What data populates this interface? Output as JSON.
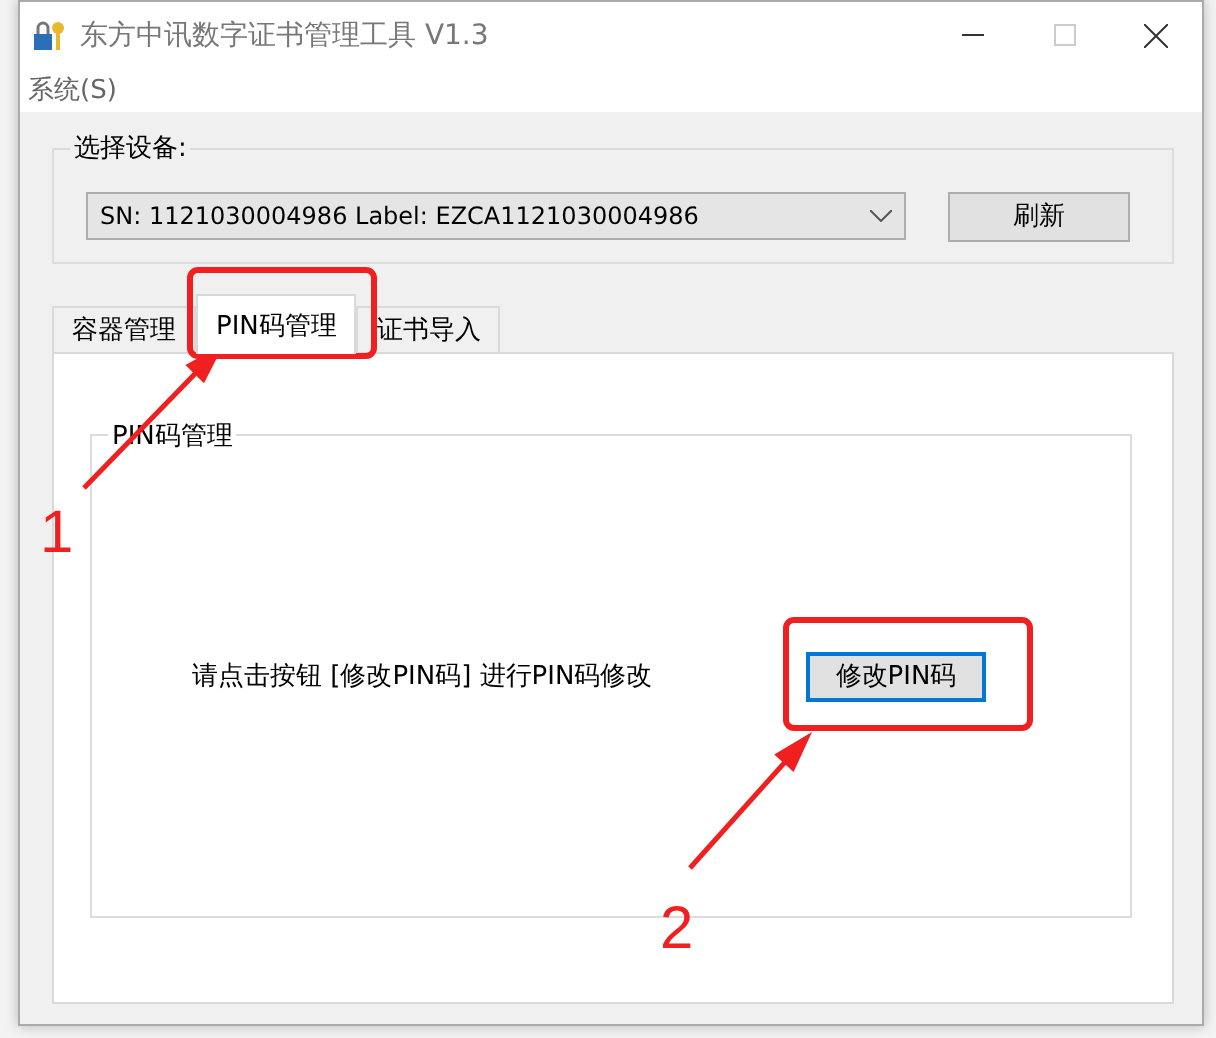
{
  "window": {
    "title": "东方中讯数字证书管理工具 V1.3"
  },
  "menu": [
    {
      "label": "系统(S)"
    }
  ],
  "device_group": {
    "title": "选择设备:",
    "device": "SN: 1121030004986  Label: EZCA1121030004986",
    "refresh_button": "刷新"
  },
  "tabs": [
    {
      "label": "容器管理",
      "selected": false
    },
    {
      "label": "PIN码管理",
      "selected": true
    },
    {
      "label": "证书导入",
      "selected": false
    }
  ],
  "pin_group": {
    "title": "PIN码管理",
    "instruction": "请点击按钮 [修改PIN码] 进行PIN码修改",
    "button": {
      "label": "修改PIN码",
      "focused": true
    }
  },
  "annotations": [
    {
      "number": "1"
    },
    {
      "number": "2"
    }
  ]
}
